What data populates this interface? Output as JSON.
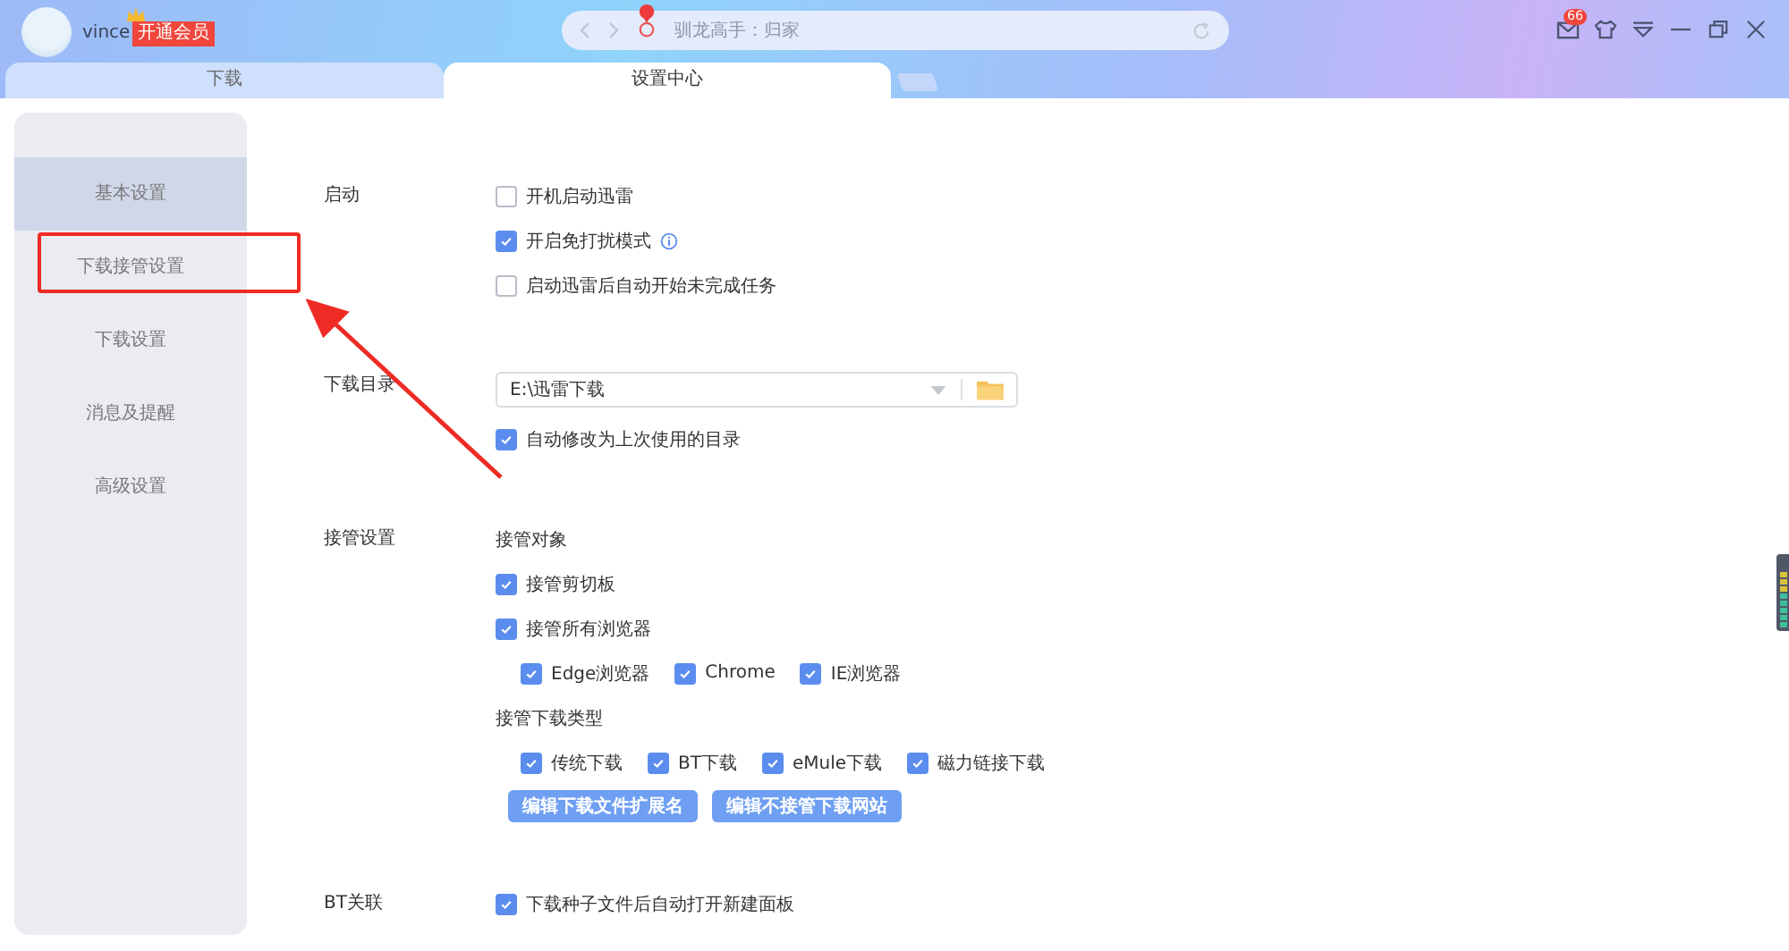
{
  "header": {
    "username": "vince",
    "vip_badge": "开通会员",
    "search": {
      "placeholder": "驯龙高手：归家"
    },
    "mail_badge": "66"
  },
  "tabs": [
    {
      "label": "下载",
      "selected": false
    },
    {
      "label": "设置中心",
      "selected": true
    }
  ],
  "sidebar": {
    "items": [
      {
        "label": "基本设置",
        "selected": true
      },
      {
        "label": "下载接管设置",
        "selected": false
      },
      {
        "label": "下载设置",
        "selected": false
      },
      {
        "label": "消息及提醒",
        "selected": false
      },
      {
        "label": "高级设置",
        "selected": false
      }
    ]
  },
  "sections": [
    {
      "label": "启动",
      "items": [
        {
          "kind": "checkbox",
          "label": "开机启动迅雷",
          "checked": false
        },
        {
          "kind": "checkbox",
          "label": "开启免打扰模式",
          "checked": true,
          "info": true
        },
        {
          "kind": "checkbox",
          "label": "启动迅雷后自动开始未完成任务",
          "checked": false
        }
      ]
    },
    {
      "label": "下载目录",
      "items": [
        {
          "kind": "folder",
          "value": "E:\\迅雷下载"
        },
        {
          "kind": "checkbox",
          "label": "自动修改为上次使用的目录",
          "checked": true
        }
      ]
    },
    {
      "label": "接管设置",
      "items": [
        {
          "kind": "heading",
          "label": "接管对象"
        },
        {
          "kind": "checkbox",
          "label": "接管剪切板",
          "checked": true
        },
        {
          "kind": "checkbox",
          "label": "接管所有浏览器",
          "checked": true
        },
        {
          "kind": "group",
          "options": [
            {
              "label": "Edge浏览器",
              "checked": true
            },
            {
              "label": "Chrome",
              "checked": true
            },
            {
              "label": "IE浏览器",
              "checked": true
            }
          ]
        },
        {
          "kind": "heading",
          "label": "接管下载类型"
        },
        {
          "kind": "group",
          "options": [
            {
              "label": "传统下载",
              "checked": true
            },
            {
              "label": "BT下载",
              "checked": true
            },
            {
              "label": "eMule下载",
              "checked": true
            },
            {
              "label": "磁力链接下载",
              "checked": true
            }
          ]
        },
        {
          "kind": "buttons",
          "buttons": [
            "编辑下载文件扩展名",
            "编辑不接管下载网站"
          ]
        }
      ]
    },
    {
      "label": "BT关联",
      "items": [
        {
          "kind": "checkbox",
          "label": "下载种子文件后自动打开新建面板",
          "checked": true
        }
      ]
    }
  ]
}
